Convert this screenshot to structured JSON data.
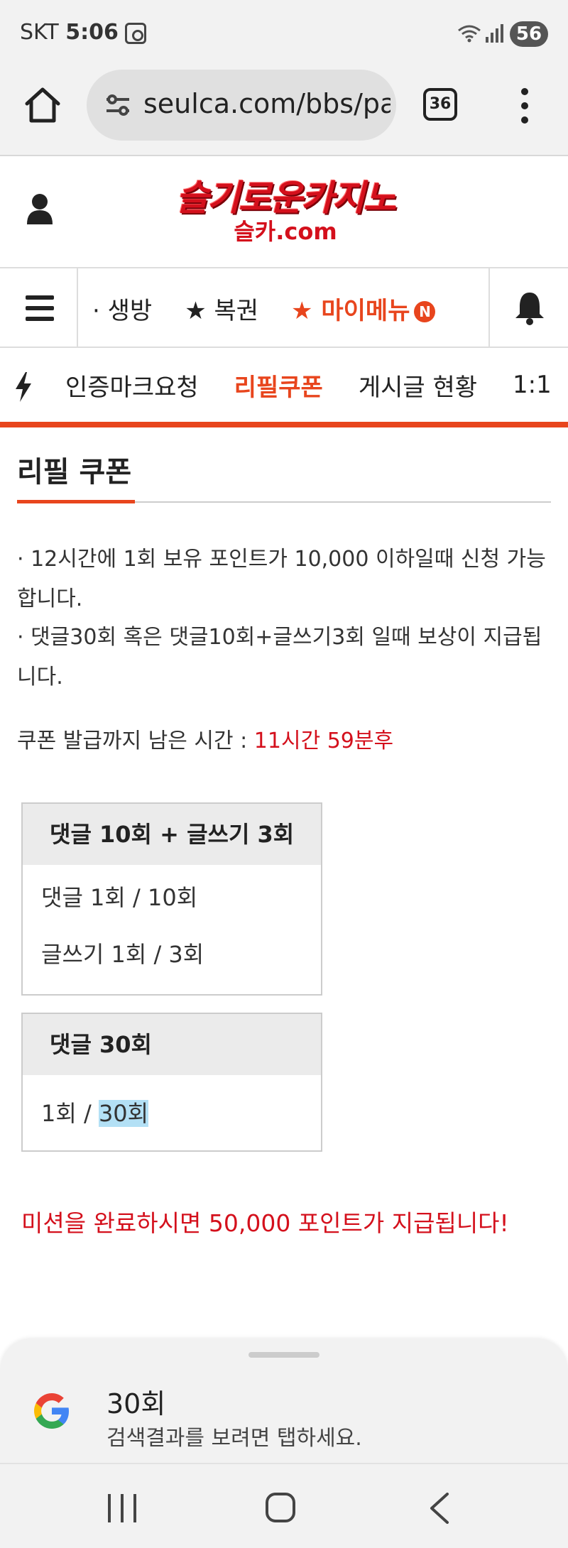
{
  "status_bar": {
    "carrier": "SKT",
    "time": "5:06",
    "battery": "56"
  },
  "browser": {
    "url": "seulca.com/bbs/pa",
    "tab_count": "36"
  },
  "site": {
    "logo_main": "슬기로운카지노",
    "logo_sub": "슬카.com"
  },
  "nav": {
    "items": [
      {
        "label": "· 생방"
      },
      {
        "label": "★ 복권"
      },
      {
        "label": "★ 마이메뉴"
      }
    ],
    "new_badge": "N"
  },
  "sub_nav": {
    "items": [
      {
        "label": "인증마크요청"
      },
      {
        "label": "리필쿠폰"
      },
      {
        "label": "게시글 현황"
      },
      {
        "label": "1:1"
      }
    ]
  },
  "content": {
    "title": "리필 쿠폰",
    "desc_1": " · 12시간에 1회 보유 포인트가 10,000 이하일때 신청 가능합니다.",
    "desc_2": " · 댓글30회 혹은 댓글10회+글쓰기3회 일때 보상이 지급됩니다.",
    "remaining_label": "쿠폰 발급까지 남은 시간 : ",
    "remaining_value": "11시간 59분후",
    "box_1": {
      "header": "댓글 10회 + 글쓰기 3회",
      "line_1": "댓글 1회 / 10회",
      "line_2": "글쓰기 1회 / 3회"
    },
    "box_2": {
      "header": "댓글 30회",
      "progress_prefix": "1회 / ",
      "progress_target": "30회"
    },
    "reward_message": "미션을 완료하시면 50,000 포인트가 지급됩니다!"
  },
  "bottom_sheet": {
    "search_term": "30회",
    "hint": "검색결과를 보려면 탭하세요."
  },
  "colors": {
    "accent": "#e8451d",
    "brand_red": "#d4101c",
    "selection": "#b3e0f5"
  }
}
